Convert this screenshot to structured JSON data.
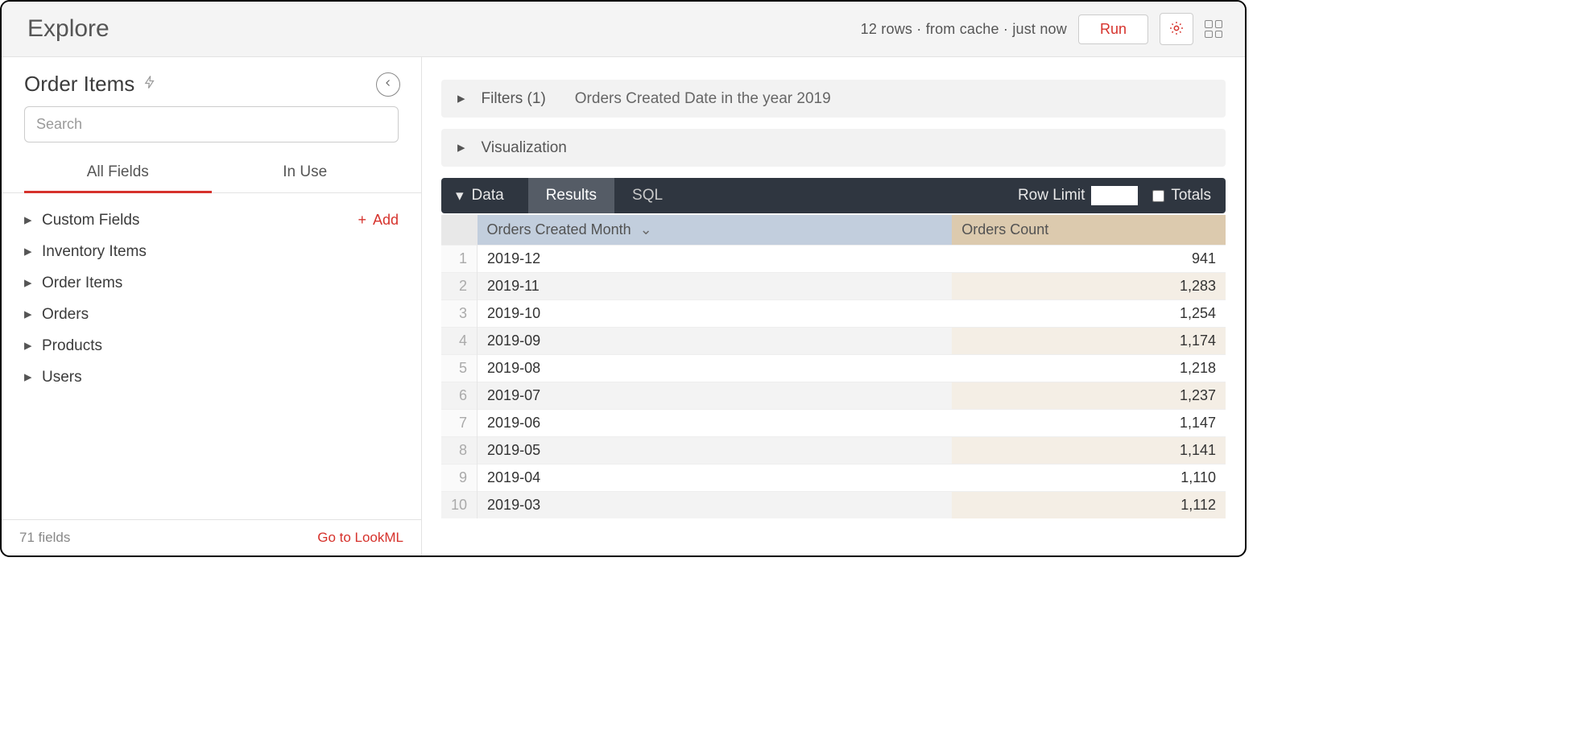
{
  "header": {
    "title": "Explore",
    "status": "12 rows  ·  from cache  ·  just now",
    "run_label": "Run"
  },
  "sidebar": {
    "explore_name": "Order Items",
    "search_placeholder": "Search",
    "tabs": {
      "all_fields": "All Fields",
      "in_use": "In Use"
    },
    "add_label": "Add",
    "groups": [
      {
        "label": "Custom Fields",
        "has_add": true
      },
      {
        "label": "Inventory Items"
      },
      {
        "label": "Order Items"
      },
      {
        "label": "Orders"
      },
      {
        "label": "Products"
      },
      {
        "label": "Users"
      }
    ],
    "footer": {
      "field_count": "71 fields",
      "lookml_link": "Go to LookML"
    }
  },
  "filters": {
    "label": "Filters (1)",
    "summary": "Orders Created Date in the year 2019"
  },
  "visualization": {
    "label": "Visualization"
  },
  "data_bar": {
    "title": "Data",
    "tab_results": "Results",
    "tab_sql": "SQL",
    "row_limit_label": "Row Limit",
    "row_limit_value": "",
    "totals_label": "Totals"
  },
  "table": {
    "columns": {
      "dimension": "Orders Created Month",
      "measure": "Orders Count"
    },
    "rows": [
      {
        "n": "1",
        "month": "2019-12",
        "count": "941"
      },
      {
        "n": "2",
        "month": "2019-11",
        "count": "1,283"
      },
      {
        "n": "3",
        "month": "2019-10",
        "count": "1,254"
      },
      {
        "n": "4",
        "month": "2019-09",
        "count": "1,174"
      },
      {
        "n": "5",
        "month": "2019-08",
        "count": "1,218"
      },
      {
        "n": "6",
        "month": "2019-07",
        "count": "1,237"
      },
      {
        "n": "7",
        "month": "2019-06",
        "count": "1,147"
      },
      {
        "n": "8",
        "month": "2019-05",
        "count": "1,141"
      },
      {
        "n": "9",
        "month": "2019-04",
        "count": "1,110"
      },
      {
        "n": "10",
        "month": "2019-03",
        "count": "1,112"
      }
    ]
  }
}
